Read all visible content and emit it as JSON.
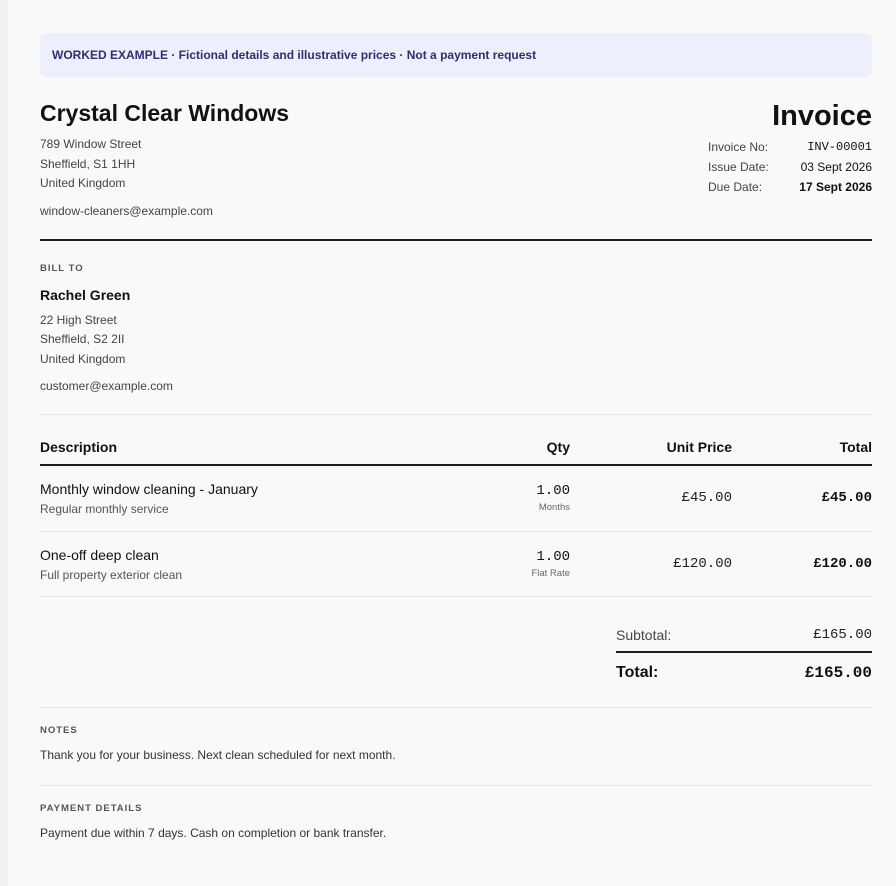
{
  "banner": "WORKED EXAMPLE · Fictional details and illustrative prices · Not a payment request",
  "company": {
    "name": "Crystal Clear Windows",
    "address": [
      "789 Window Street",
      "Sheffield, S1 1HH",
      "United Kingdom"
    ],
    "email": "window-cleaners@example.com"
  },
  "invoice": {
    "title": "Invoice",
    "number_label": "Invoice No:",
    "number": "INV-00001",
    "issue_label": "Issue Date:",
    "issue_date": "03 Sept 2026",
    "due_label": "Due Date:",
    "due_date": "17 Sept 2026"
  },
  "bill_to": {
    "label": "BILL TO",
    "name": "Rachel Green",
    "address": [
      "22 High Street",
      "Sheffield, S2 2II",
      "United Kingdom"
    ],
    "email": "customer@example.com"
  },
  "table": {
    "headers": {
      "description": "Description",
      "qty": "Qty",
      "unit_price": "Unit Price",
      "total": "Total"
    },
    "rows": [
      {
        "title": "Monthly window cleaning - January",
        "subtitle": "Regular monthly service",
        "qty": "1.00",
        "unit": "Months",
        "unit_price": "£45.00",
        "total": "£45.00"
      },
      {
        "title": "One-off deep clean",
        "subtitle": "Full property exterior clean",
        "qty": "1.00",
        "unit": "Flat Rate",
        "unit_price": "£120.00",
        "total": "£120.00"
      }
    ]
  },
  "totals": {
    "subtotal_label": "Subtotal:",
    "subtotal": "£165.00",
    "total_label": "Total:",
    "total": "£165.00"
  },
  "notes": {
    "label": "NOTES",
    "text": "Thank you for your business. Next clean scheduled for next month."
  },
  "payment": {
    "label": "PAYMENT DETAILS",
    "text": "Payment due within 7 days. Cash on completion or bank transfer."
  }
}
